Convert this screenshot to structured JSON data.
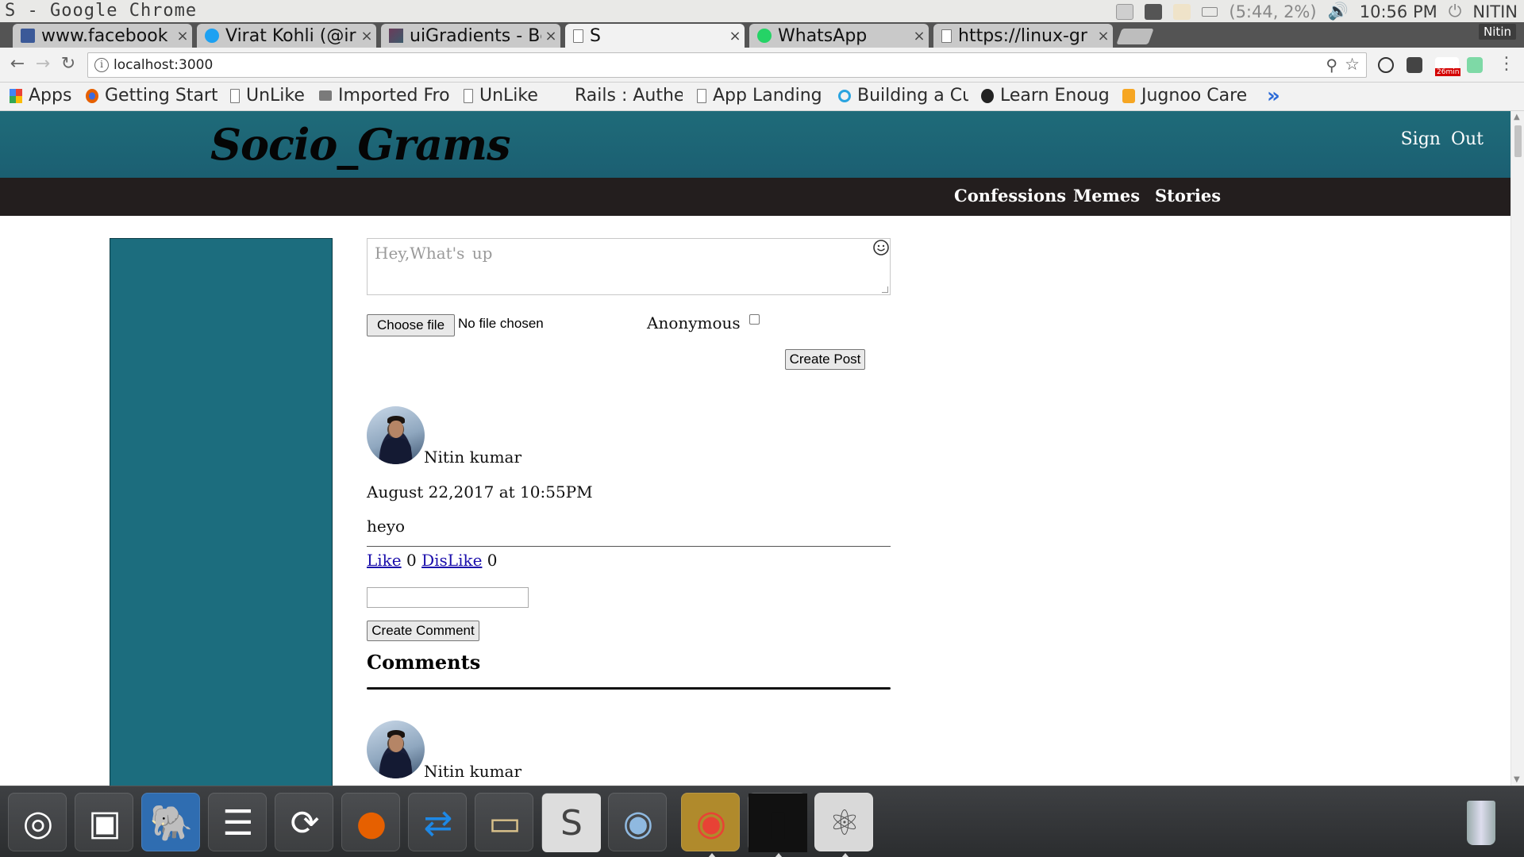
{
  "os_panel": {
    "window_title": "S - Google Chrome",
    "battery": "(5:44, 2%)",
    "clock": "10:56 PM",
    "user": "NITIN"
  },
  "tabs": [
    {
      "label": "www.facebook",
      "favicon": "facebook-icon",
      "color": "#3b5998"
    },
    {
      "label": "Virat Kohli (@ir",
      "favicon": "twitter-icon",
      "color": "#1da1f2"
    },
    {
      "label": "uiGradients - Be",
      "favicon": "uigradients-icon",
      "color": "#6b3b5a"
    },
    {
      "label": "S",
      "favicon": "page-icon",
      "color": "#777777"
    },
    {
      "label": "WhatsApp",
      "favicon": "whatsapp-icon",
      "color": "#25d366"
    },
    {
      "label": "https://linux-gr",
      "favicon": "page-icon",
      "color": "#777777"
    }
  ],
  "profile_name": "Nitin",
  "toolbar": {
    "url": "localhost:3000",
    "extension_badge": "26min"
  },
  "bookmarks": [
    {
      "label": "Apps",
      "icon": "apps-grid-icon"
    },
    {
      "label": "Getting Start",
      "icon": "firefox-icon"
    },
    {
      "label": "UnLike",
      "icon": "page-icon"
    },
    {
      "label": "Imported Fro",
      "icon": "folder-icon"
    },
    {
      "label": "UnLike",
      "icon": "page-icon"
    },
    {
      "label": "Rails : Auther",
      "icon": "none"
    },
    {
      "label": "App Landing",
      "icon": "page-icon"
    },
    {
      "label": "Building a Cu",
      "icon": "gear-icon"
    },
    {
      "label": "Learn Enoug",
      "icon": "learn-icon"
    },
    {
      "label": "Jugnoo Care",
      "icon": "jugnoo-icon"
    }
  ],
  "bookmarks_more": "»",
  "site": {
    "logo": "Socio_Grams",
    "signout": "Sign Out",
    "nav": [
      "Confessions",
      "Memes",
      "Stories"
    ],
    "accent": "#1c6d7e",
    "nav_bg": "#231e1e"
  },
  "post_form": {
    "placeholder": "Hey,What's  up",
    "choose_file": "Choose file",
    "no_file": "No file chosen",
    "anonymous": "Anonymous",
    "create_post": "Create Post"
  },
  "post": {
    "author": "Nitin kumar",
    "timestamp": "August 22,2017 at 10:55PM",
    "content": "heyo",
    "like_label": "Like",
    "like_count": "0",
    "dislike_label": "DisLike",
    "dislike_count": "0",
    "create_comment": "Create Comment",
    "comments_heading": "Comments"
  },
  "comment": {
    "author": "Nitin kumar"
  },
  "dock": [
    {
      "name": "ubuntu-launcher-icon",
      "glyph": "◎"
    },
    {
      "name": "image-viewer-icon",
      "glyph": "▣"
    },
    {
      "name": "postgresql-icon",
      "glyph": "🐘"
    },
    {
      "name": "database-icon",
      "glyph": "☰"
    },
    {
      "name": "software-updater-icon",
      "glyph": "⟳"
    },
    {
      "name": "firefox-icon",
      "glyph": "●"
    },
    {
      "name": "teamviewer-icon",
      "glyph": "⇄"
    },
    {
      "name": "files-icon",
      "glyph": "▭"
    },
    {
      "name": "sublime-text-icon",
      "glyph": "S"
    },
    {
      "name": "chromium-icon",
      "glyph": "◉"
    },
    {
      "name": "chrome-icon",
      "glyph": "◉"
    },
    {
      "name": "terminal-icon",
      "glyph": "▮"
    },
    {
      "name": "atom-icon",
      "glyph": "⚛"
    }
  ]
}
